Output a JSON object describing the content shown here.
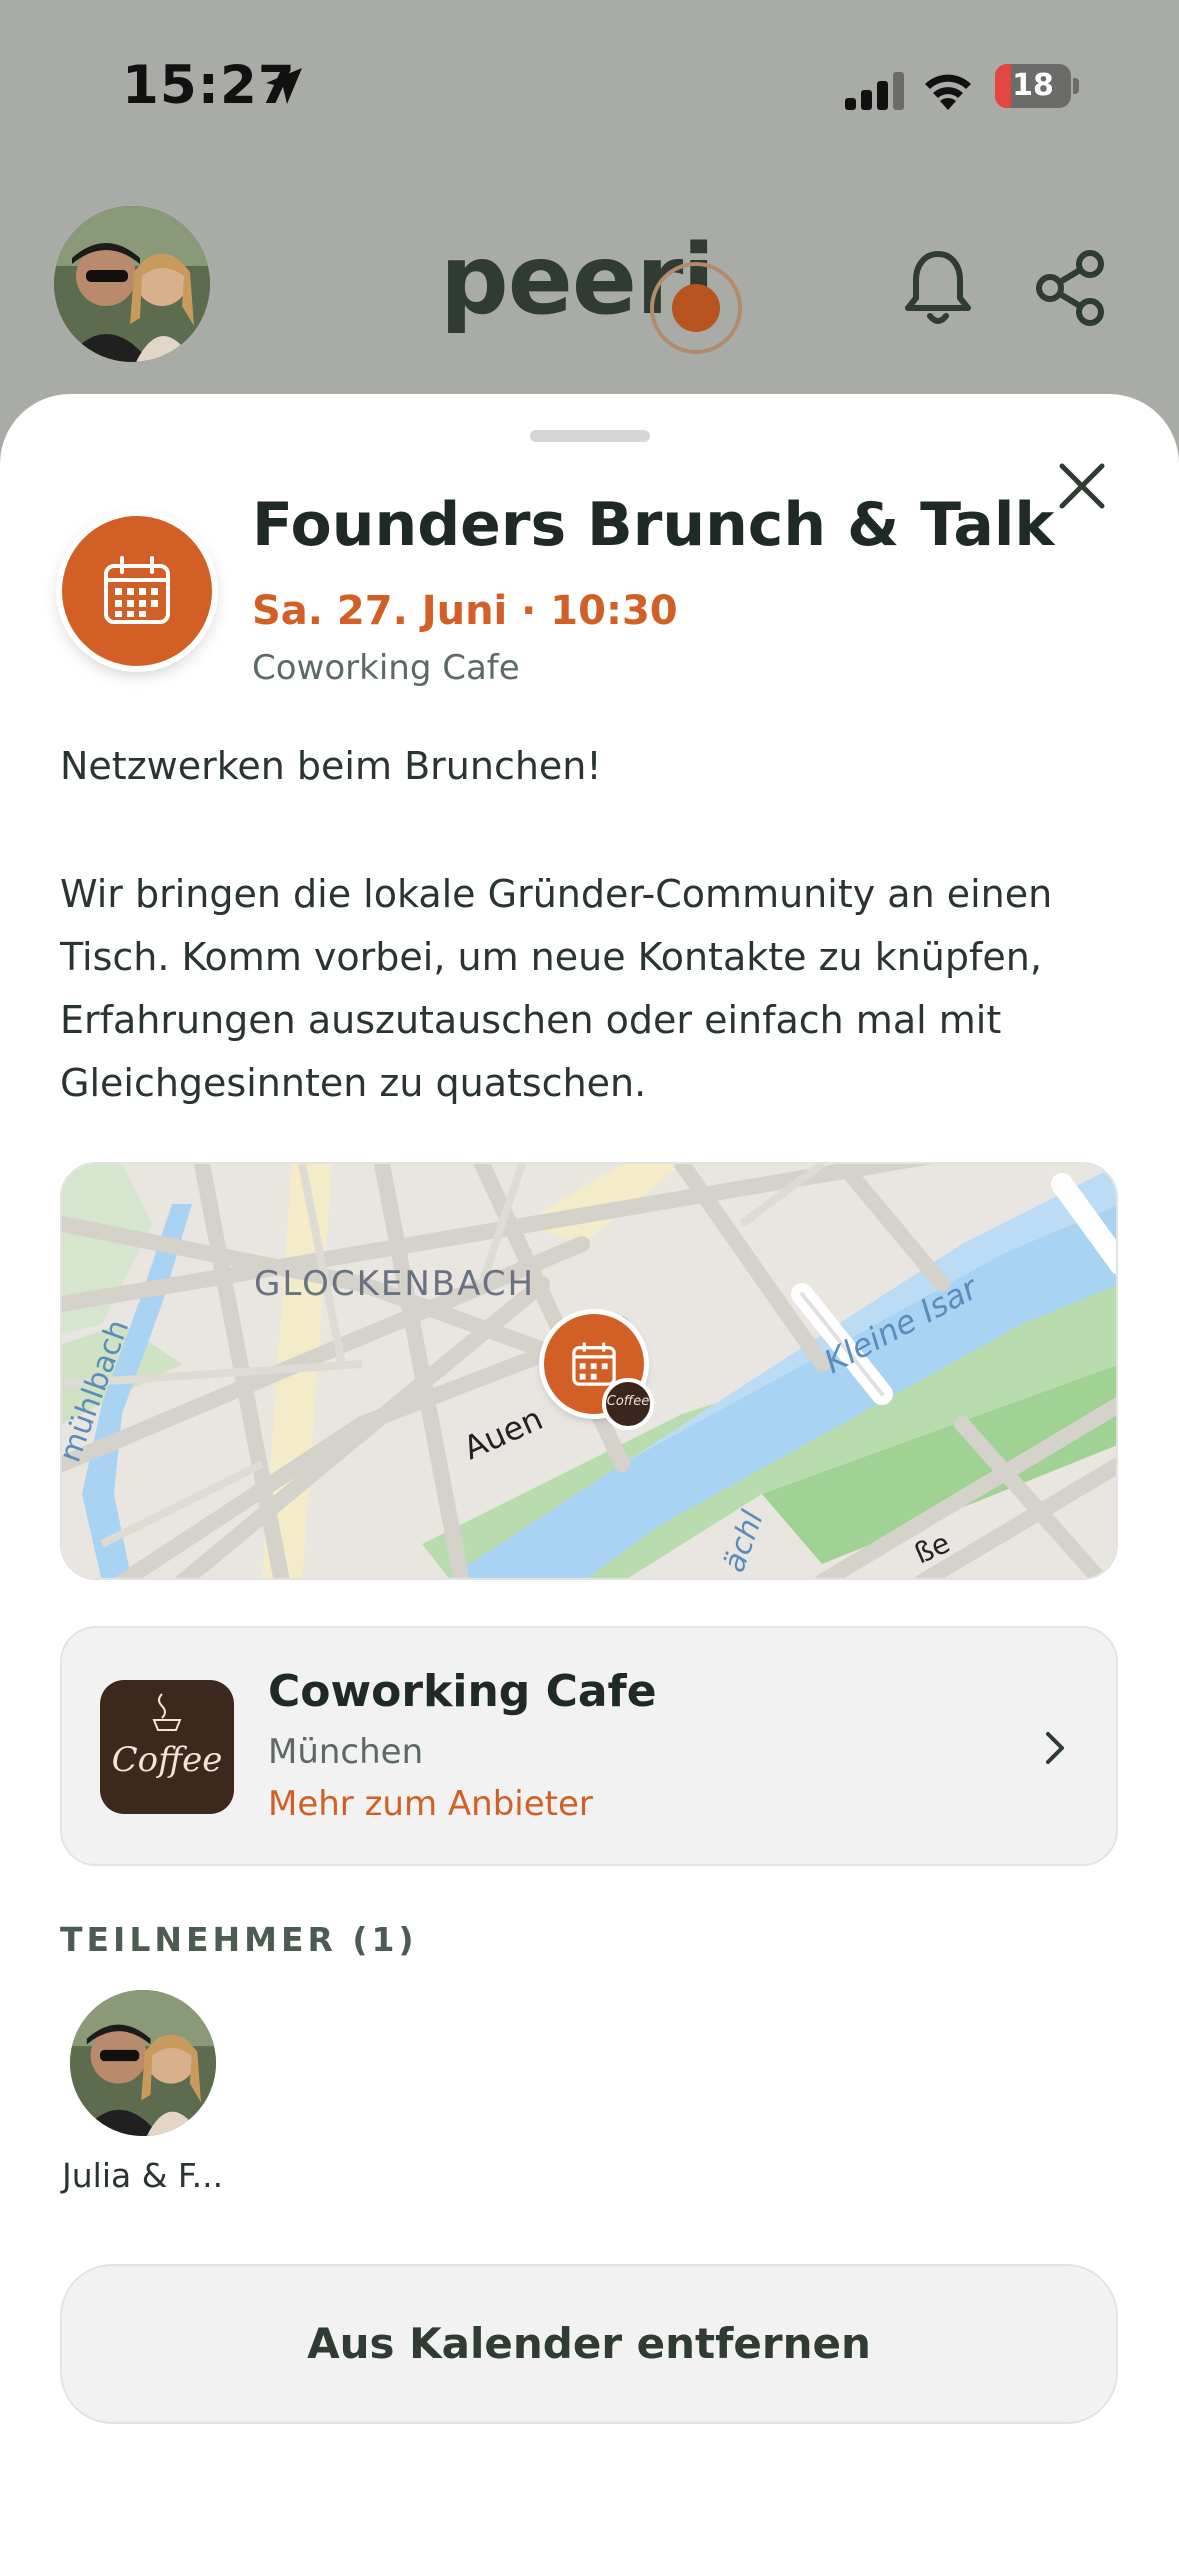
{
  "status_bar": {
    "time": "15:27",
    "battery": "18",
    "location_icon": "location-arrow-icon",
    "signal_icon": "cellular-signal-icon",
    "wifi_icon": "wifi-icon",
    "battery_icon": "battery-low-icon"
  },
  "header": {
    "logo_text": "peeri",
    "icons": [
      "bell-icon",
      "share-icon"
    ]
  },
  "event": {
    "title": "Founders Brunch & Talk",
    "date": "Sa. 27. Juni · 10:30",
    "venue": "Coworking Cafe",
    "icon": "calendar-icon",
    "description": [
      "Netzwerken beim Brunchen!",
      "Wir bringen die lokale Gründer-Community an einen",
      "Tisch. Komm vorbei, um neue Kontakte zu knüpfen,",
      "Erfahrungen auszutauschen oder einfach mal mit",
      "Gleichgesinnten zu quatschen."
    ]
  },
  "map": {
    "district_label": "GLOCKENBACH",
    "river_label": "Kleine Isar",
    "street_labels": [
      "Auen",
      "mühlbach",
      "ächl",
      "ße"
    ]
  },
  "provider": {
    "name": "Coworking Cafe",
    "city": "München",
    "link": "Mehr zum Anbieter",
    "logo_text": "Coffee"
  },
  "participants": {
    "heading": "TEILNEHMER (1)",
    "items": [
      {
        "name": "Julia & F..."
      }
    ]
  },
  "actions": {
    "remove_label": "Aus Kalender entfernen"
  },
  "colors": {
    "accent": "#d25f25",
    "text_dark": "#1f2a24",
    "text_muted": "#5c6a62",
    "overlay": "#a9aba7",
    "card_bg": "#f1f2f1"
  }
}
